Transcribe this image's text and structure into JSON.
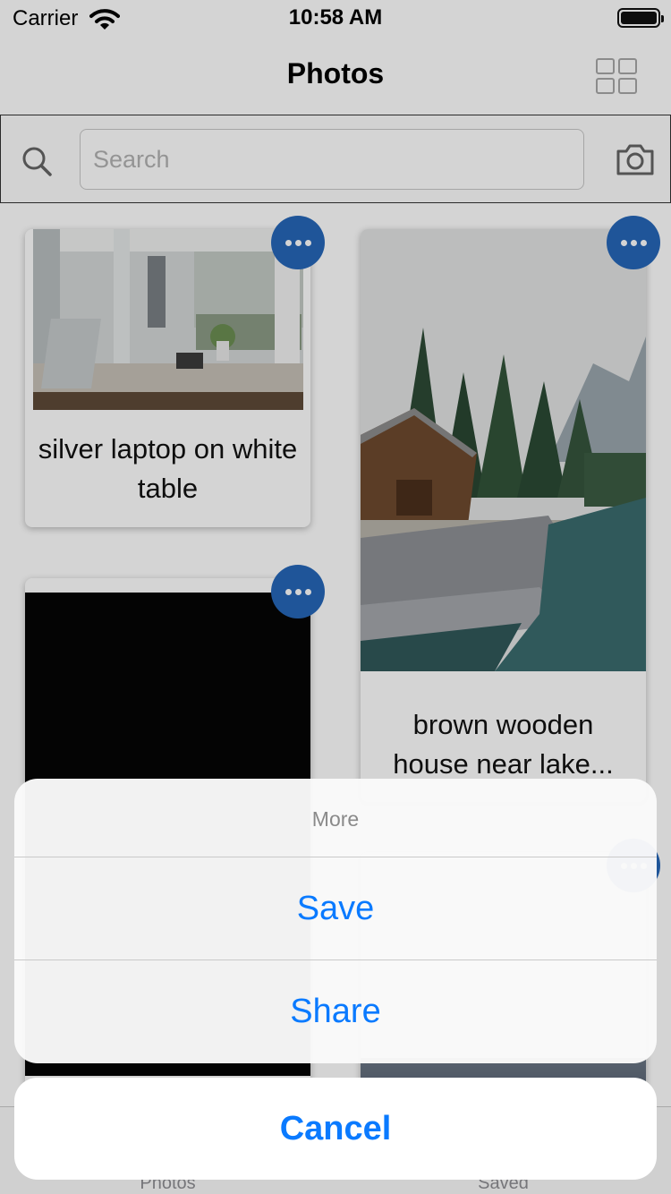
{
  "status_bar": {
    "carrier": "Carrier",
    "time": "10:58 AM"
  },
  "nav": {
    "title": "Photos"
  },
  "search": {
    "placeholder": "Search",
    "value": ""
  },
  "photos": [
    {
      "caption": "silver laptop on white table"
    },
    {
      "caption": "brown wooden house near lake..."
    }
  ],
  "tab_bar": {
    "items": [
      {
        "label": "Photos"
      },
      {
        "label": "Saved"
      }
    ]
  },
  "action_sheet": {
    "title": "More",
    "actions": [
      {
        "label": "Save"
      },
      {
        "label": "Share"
      }
    ],
    "cancel_label": "Cancel"
  },
  "colors": {
    "accent": "#0a7aff",
    "more_button": "#2667b9"
  },
  "icons": [
    "wifi-icon",
    "battery-icon",
    "grid-view-icon",
    "search-icon",
    "camera-icon",
    "more-icon"
  ]
}
